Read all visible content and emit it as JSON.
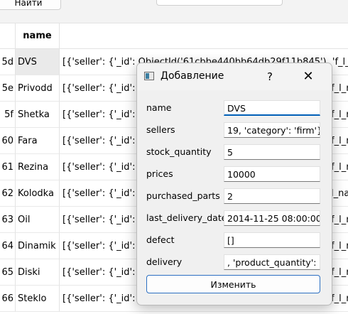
{
  "toolbar": {
    "find_label": "Найти"
  },
  "table": {
    "header_name": "name",
    "rows": [
      {
        "num": "5d",
        "name": "DVS",
        "rest": "[{'seller': {'_id': ObjectId('61cbbe440bb64db29f11b845'), 'f_l_n",
        "right": ""
      },
      {
        "num": "5e",
        "name": "Privodd",
        "rest": "[{'seller': {'_id': O",
        "right": "f_l_n"
      },
      {
        "num": "5f",
        "name": "Shetka",
        "rest": "[{'seller': {'_id': O",
        "right": "f_l_n"
      },
      {
        "num": "60",
        "name": "Fara",
        "rest": "[{'seller': {'_id': O",
        "right": "f_l_n"
      },
      {
        "num": "61",
        "name": "Rezina",
        "rest": "[{'seller': {'_id': O",
        "right": "f_l_n"
      },
      {
        "num": "62",
        "name": "Kolodka",
        "rest": "[{'seller': {'_id': O",
        "right": "l_na"
      },
      {
        "num": "63",
        "name": "Oil",
        "rest": "[{'seller': {'_id': O",
        "right": "f_l_n"
      },
      {
        "num": "64",
        "name": "Dinamik",
        "rest": "[{'seller': {'_id': O",
        "right": "f_l_n"
      },
      {
        "num": "65",
        "name": "Diski",
        "rest": "[{'seller': {'_id': O",
        "right": "f_l_n"
      },
      {
        "num": "66",
        "name": "Steklo",
        "rest": "[{'seller': {'_id': O",
        "right": "f_l_n"
      }
    ]
  },
  "dialog": {
    "title": "Добавление",
    "help": "?",
    "close": "✕",
    "fields": [
      {
        "label": "name",
        "value": "DVS"
      },
      {
        "label": "sellers",
        "value": "19, 'category': 'firm'}}]"
      },
      {
        "label": "stock_quantity",
        "value": "5"
      },
      {
        "label": "prices",
        "value": "10000"
      },
      {
        "label": "purchased_parts",
        "value": "2"
      },
      {
        "label": "last_delivery_date",
        "value": "2014-11-25 08:00:00"
      },
      {
        "label": "defect",
        "value": "[]"
      },
      {
        "label": "delivery",
        "value": ", 'product_quantity': 5}]"
      }
    ],
    "submit_label": "Изменить"
  }
}
